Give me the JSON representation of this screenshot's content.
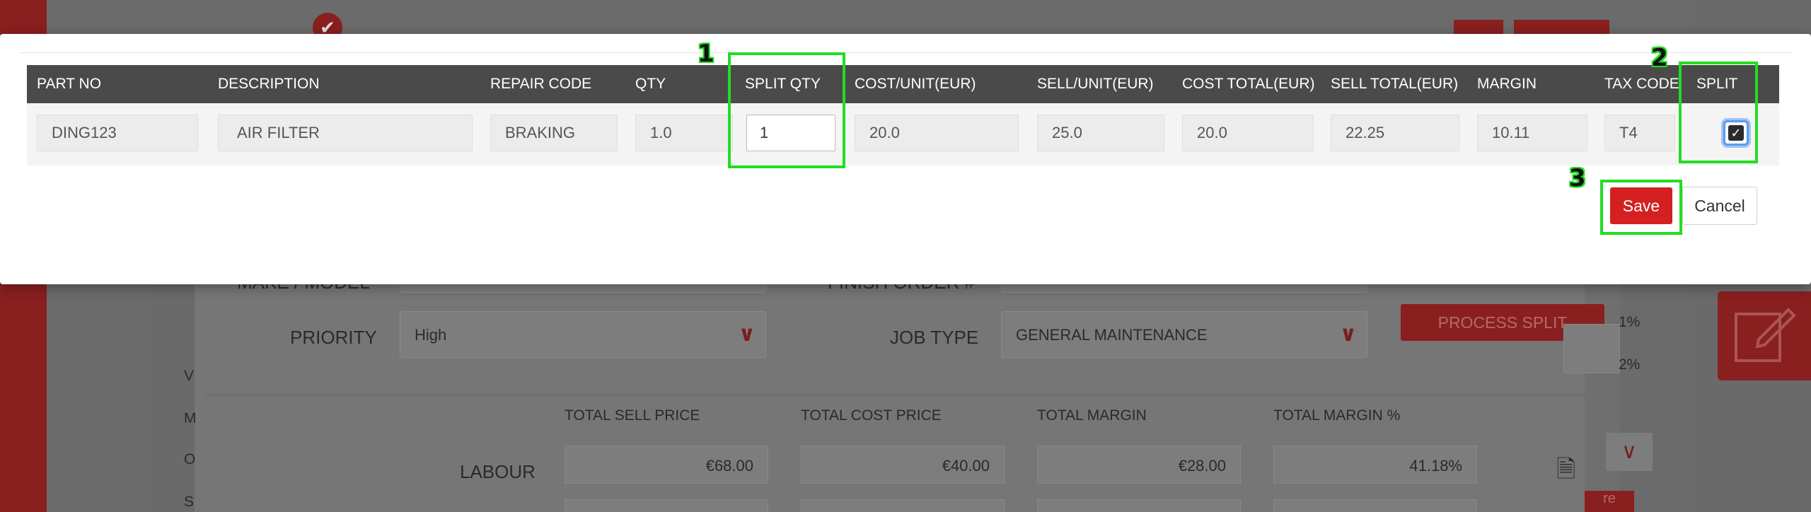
{
  "modal": {
    "columns": [
      "PART NO",
      "DESCRIPTION",
      "REPAIR CODE",
      "QTY",
      "SPLIT QTY",
      "COST/UNIT(EUR)",
      "SELL/UNIT(EUR)",
      "COST TOTAL(EUR)",
      "SELL TOTAL(EUR)",
      "MARGIN",
      "TAX CODE",
      "SPLIT"
    ],
    "row": {
      "part_no": "DING123",
      "description": "AIR FILTER",
      "repair_code": "BRAKING",
      "qty": "1.0",
      "split_qty": "1",
      "cost_unit": "20.0",
      "sell_unit": "25.0",
      "cost_total": "20.0",
      "sell_total": "22.25",
      "margin": "10.11",
      "tax_code": "T4",
      "split_checked": true
    },
    "save_label": "Save",
    "cancel_label": "Cancel"
  },
  "annotations": [
    "1",
    "2",
    "3"
  ],
  "background": {
    "make_model_label": "MAKE / MODEL",
    "finish_order_label": "FINISH ORDER #",
    "priority_label": "PRIORITY",
    "priority_value": "High",
    "job_type_label": "JOB TYPE",
    "job_type_value": "GENERAL MAINTENANCE",
    "process_split_label": "PROCESS SPLIT",
    "totals_headers": [
      "TOTAL SELL PRICE",
      "TOTAL COST PRICE",
      "TOTAL MARGIN",
      "TOTAL MARGIN %"
    ],
    "labour_label": "LABOUR",
    "labour_values": [
      "€68.00",
      "€40.00",
      "€28.00",
      "41.18%"
    ],
    "side_letters": [
      "V",
      "M",
      "O",
      "S"
    ],
    "pct_1": "1%",
    "pct_2": "2%",
    "save_partial": "re"
  },
  "colors": {
    "accent": "#d42020",
    "header": "#4a4a4a",
    "highlight": "#22dd22"
  }
}
